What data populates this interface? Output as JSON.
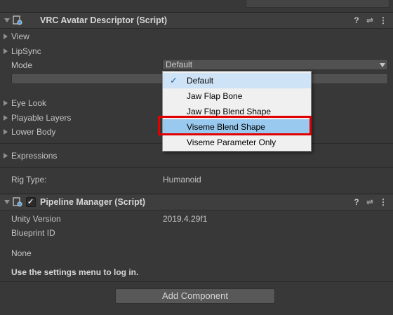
{
  "descriptor": {
    "title": "VRC Avatar Descriptor (Script)",
    "view_label": "View",
    "lipsync_label": "LipSync",
    "mode_label": "Mode",
    "mode_value": "Default",
    "eye_look_label": "Eye Look",
    "playable_layers_label": "Playable Layers",
    "lower_body_label": "Lower Body",
    "expressions_label": "Expressions",
    "rig_type_label": "Rig Type:",
    "rig_type_value": "Humanoid"
  },
  "dropdown_menu": {
    "items": [
      {
        "label": "Default",
        "checked": true
      },
      {
        "label": "Jaw Flap Bone"
      },
      {
        "label": "Jaw Flap Blend Shape"
      },
      {
        "label": "Viseme Blend Shape",
        "highlighted": true
      },
      {
        "label": "Viseme Parameter Only"
      }
    ],
    "check_glyph": "✓"
  },
  "pipeline": {
    "title": "Pipeline Manager (Script)",
    "unity_version_label": "Unity Version",
    "unity_version_value": "2019.4.29f1",
    "blueprint_id_label": "Blueprint ID",
    "none_label": "None",
    "login_message": "Use the settings menu to log in."
  },
  "add_component_label": "Add Component",
  "header_icons": {
    "help": "?",
    "presets": "⇌",
    "menu": "⋮"
  },
  "colors": {
    "highlight_border": "#e00000",
    "menu_selection": "#99c9ef"
  }
}
